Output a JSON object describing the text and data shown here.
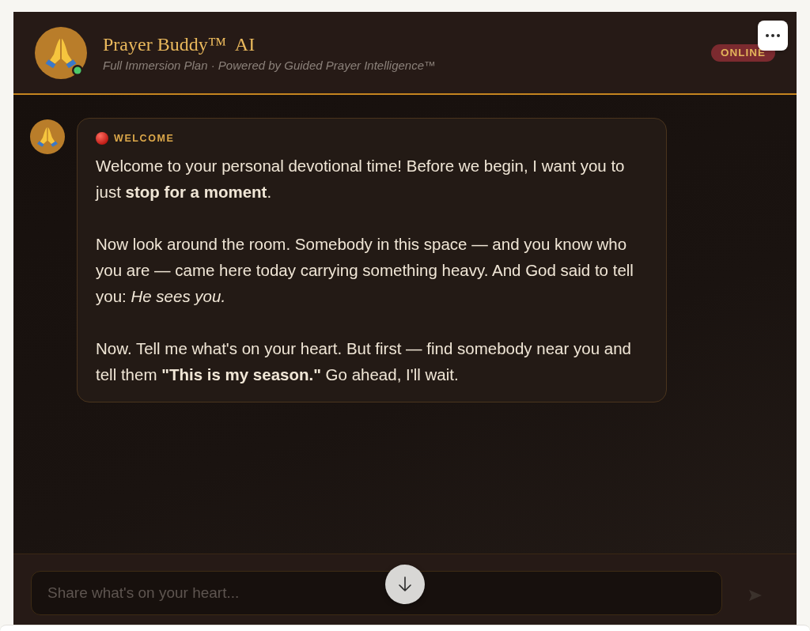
{
  "header": {
    "avatar": {
      "online": true
    },
    "title": "Prayer Buddy™  AI",
    "subtitle": "Full Immersion Plan · Powered by Guided Prayer Intelligence™",
    "status_badge": "ONLINE"
  },
  "messages": [
    {
      "label": "WELCOME",
      "paragraphs": [
        "Welcome to your personal devotional time! Before we begin, I want you to just **stop for a moment**.",
        "Now look around the room. Somebody in this space — and you know who you are — came here today carrying something heavy. And God said to tell you: *He sees you.*",
        "Now. Tell me what's on your heart. But first — find somebody near you and tell them **\"This is my season.\"** Go ahead, I'll wait."
      ]
    }
  ],
  "composer": {
    "placeholder": "Share what's on your heart..."
  }
}
